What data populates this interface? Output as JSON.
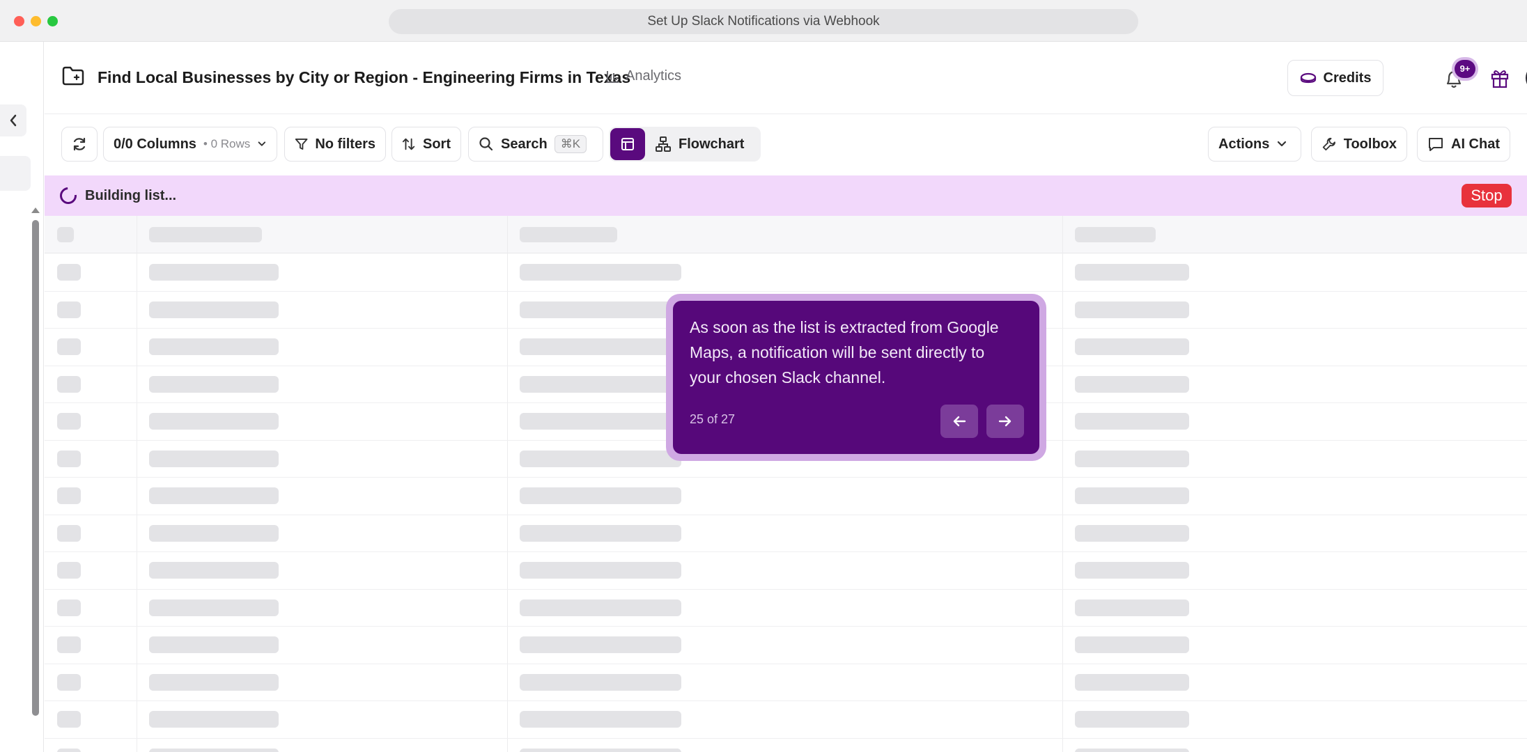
{
  "window": {
    "url_title": "Set Up Slack Notifications via Webhook"
  },
  "header": {
    "title": "Find Local Businesses by City or Region - Engineering Firms in Texas",
    "analytics_label": "Analytics",
    "credits_label": "Credits",
    "notification_badge": "9+"
  },
  "toolbar": {
    "columns_label": "0/0 Columns",
    "rows_label": "• 0 Rows",
    "filters_label": "No filters",
    "sort_label": "Sort",
    "search_label": "Search",
    "search_shortcut": "⌘K",
    "flowchart_label": "Flowchart",
    "actions_label": "Actions",
    "toolbox_label": "Toolbox",
    "ai_chat_label": "AI Chat"
  },
  "banner": {
    "status_text": "Building list...",
    "stop_label": "Stop"
  },
  "tour": {
    "message": "As soon as the list is extracted from Google Maps, a notification will be sent directly to your chosen Slack channel.",
    "progress": "25 of 27"
  },
  "colors": {
    "accent": "#5a0a7e",
    "banner_bg": "#f2d8fb",
    "stop": "#e8323c"
  },
  "icons": [
    "chevron-left-icon",
    "folder-icon",
    "bar-chart-icon",
    "coin-icon",
    "bell-icon",
    "gift-icon",
    "refresh-icon",
    "chevron-down-icon",
    "filter-icon",
    "sort-icon",
    "search-icon",
    "table-icon",
    "flowchart-icon",
    "wrench-icon",
    "chat-icon",
    "spinner-icon",
    "arrow-left-icon",
    "arrow-right-icon"
  ]
}
